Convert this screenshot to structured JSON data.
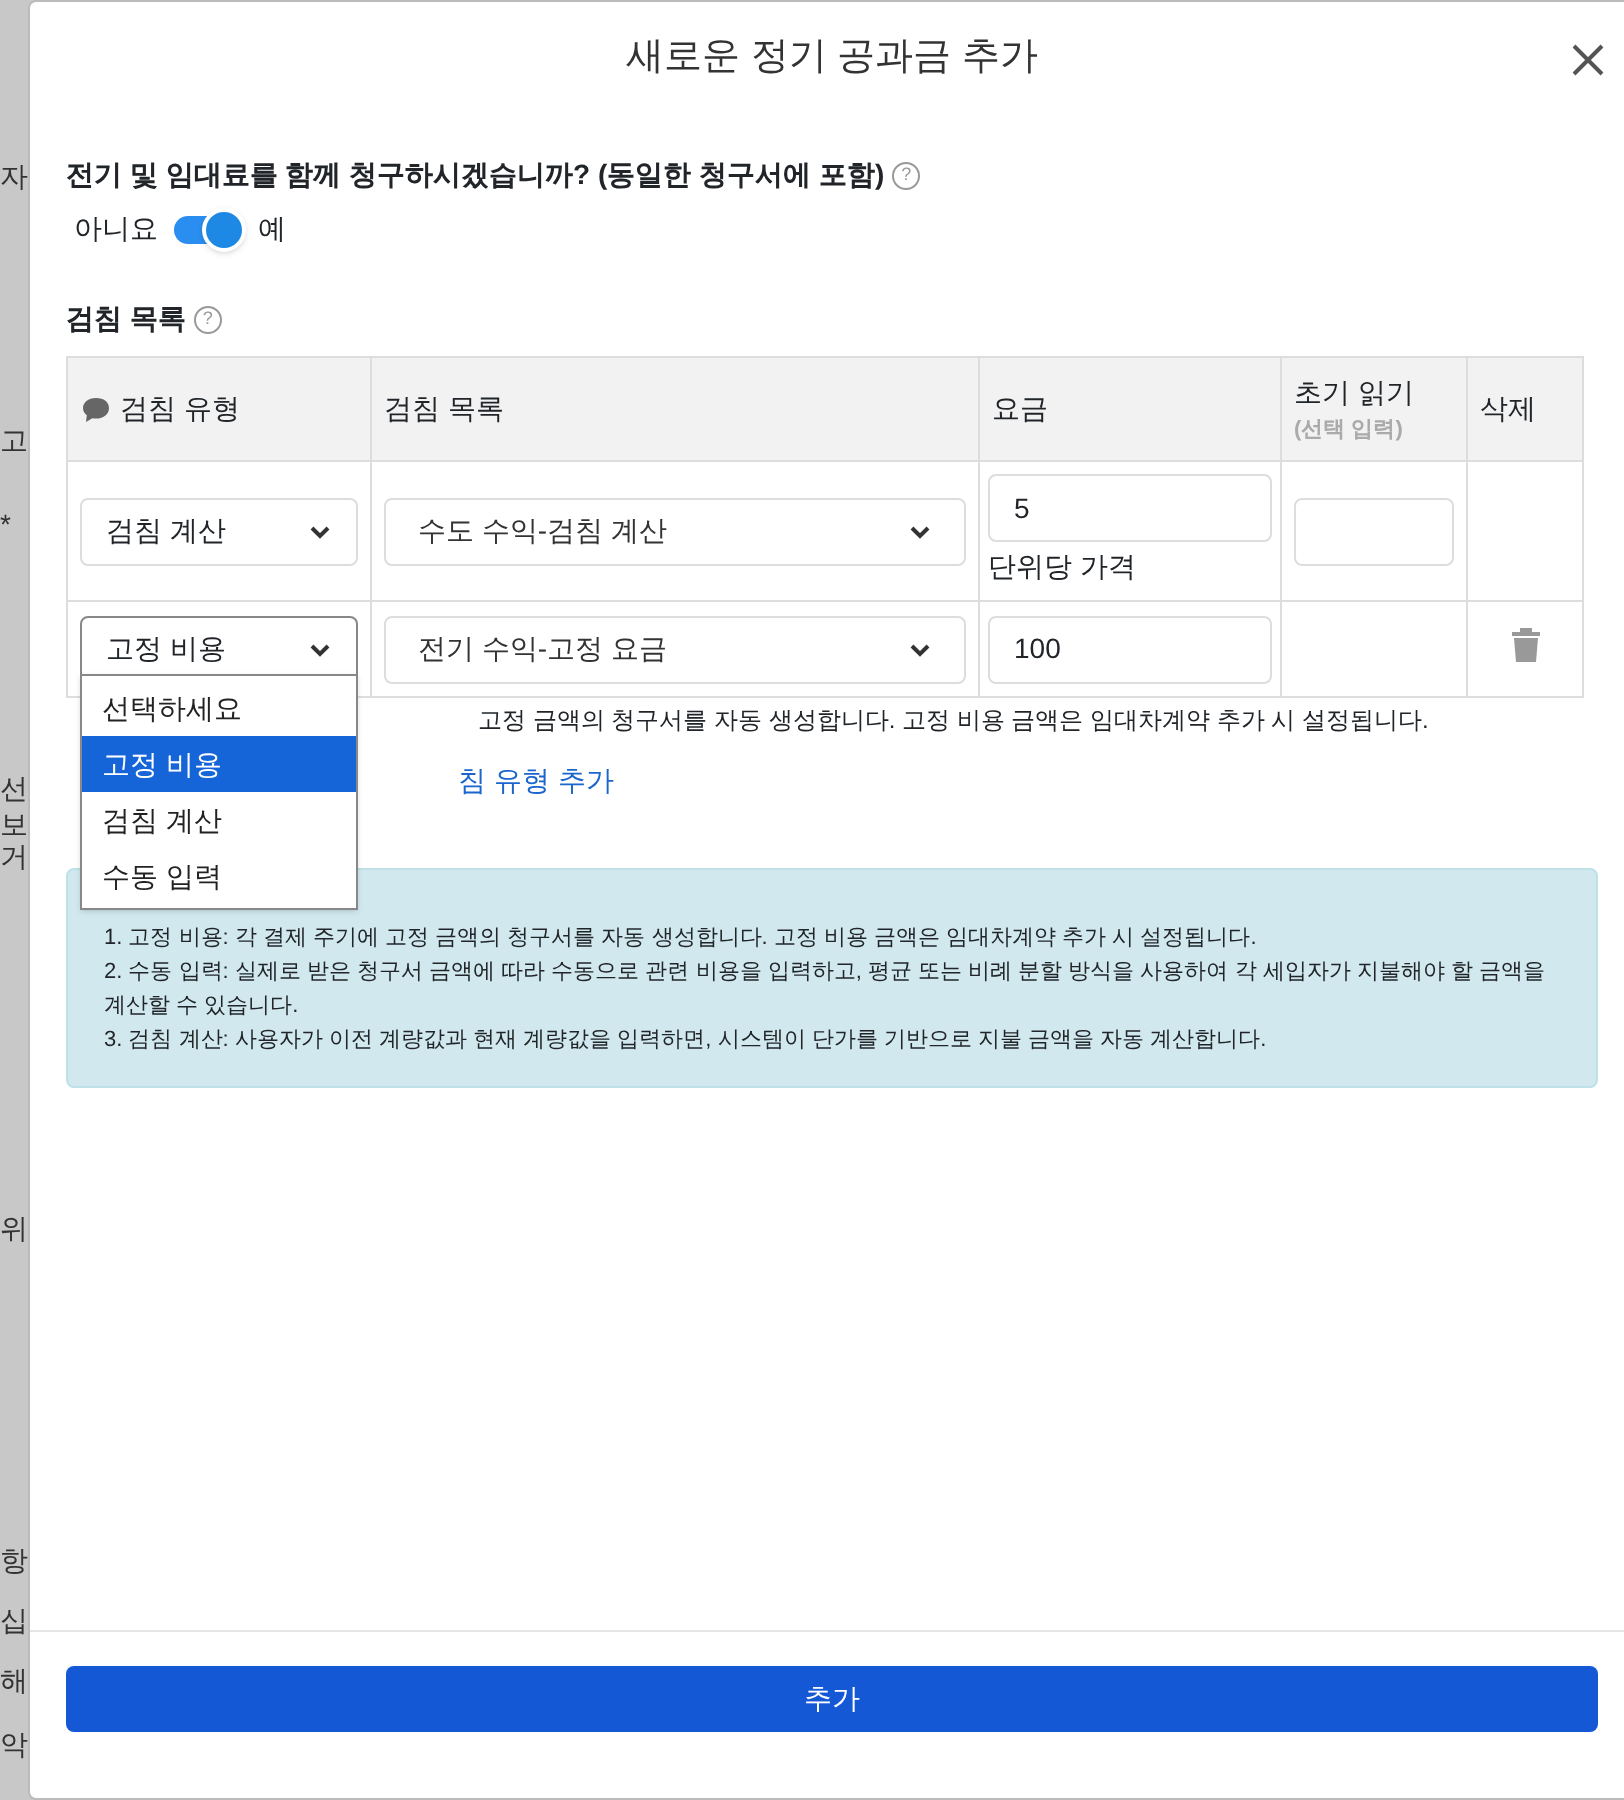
{
  "backdrop": {
    "fragments": [
      "자",
      "고",
      "*",
      "선",
      "보",
      "거",
      "위",
      "항",
      "십",
      "해",
      "악"
    ]
  },
  "dialog": {
    "title": "새로운 정기 공과금 추가",
    "question": "전기 및 임대료를 함께 청구하시겠습니까? (동일한 청구서에 포함)",
    "toggle": {
      "off_label": "아니요",
      "on_label": "예",
      "on": true
    },
    "section_title": "검침 목록",
    "help_glyphs": [
      "?",
      "?"
    ],
    "table": {
      "columns": [
        "검침 유형",
        "검침 목록",
        "요금",
        "초기 읽기",
        "삭제"
      ],
      "column_hint": "(선택 입력)",
      "rows": [
        {
          "type": "검침 계산",
          "item": "수도 수익-검침 계산",
          "fee": "5",
          "fee_note": "단위당 가격",
          "show_initial": true,
          "deletable": false
        },
        {
          "type": "고정 비용",
          "item": "전기 수익-고정 요금",
          "fee": "100",
          "show_initial": false,
          "deletable": true
        }
      ]
    },
    "dropdown": {
      "options": [
        {
          "label": "선택하세요",
          "selected": false
        },
        {
          "label": "고정 비용",
          "selected": true
        },
        {
          "label": "검침 계산",
          "selected": false
        },
        {
          "label": "수동 입력",
          "selected": false
        }
      ]
    },
    "helper_text": "고정 금액의 청구서를 자동 생성합니다. 고정 비용 금액은 임대차계약 추가 시 설정됩니다.",
    "add_link": "침 유형 추가",
    "info": [
      "1. 고정 비용: 각 결제 주기에 고정 금액의 청구서를 자동 생성합니다. 고정 비용 금액은 임대차계약 추가 시 설정됩니다.",
      "2. 수동 입력: 실제로 받은 청구서 금액에 따라 수동으로 관련 비용을 입력하고, 평균 또는 비례 분할 방식을 사용하여 각 세입자가 지불해야 할 금액을 계산할 수 있습니다.",
      "3. 검침 계산: 사용자가 이전 계량값과 현재 계량값을 입력하면, 시스템이 단가를 기반으로 지불 금액을 자동 계산합니다."
    ],
    "submit": "추가"
  }
}
